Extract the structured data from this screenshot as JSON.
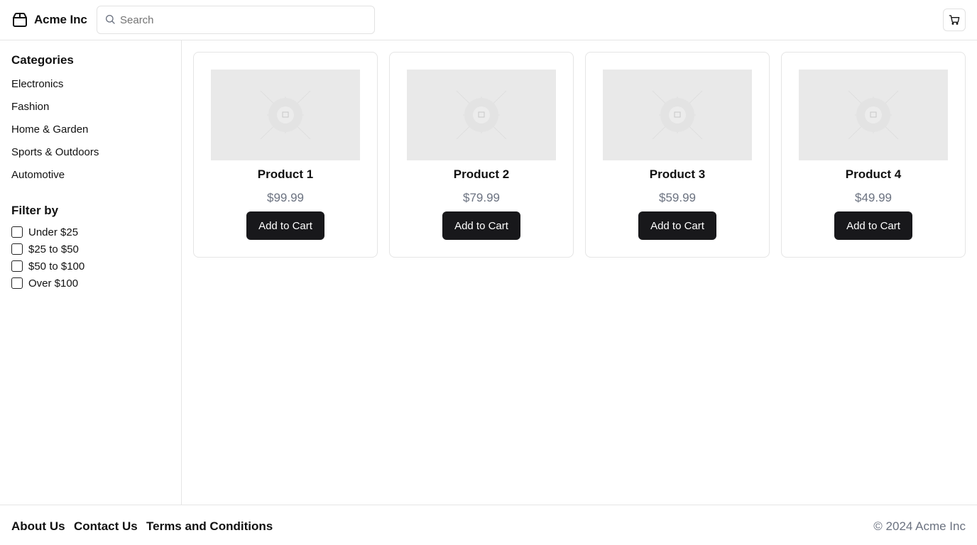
{
  "header": {
    "brand_name": "Acme Inc",
    "brand_icon": "package-icon",
    "search_placeholder": "Search",
    "search_value": "",
    "cart_icon": "shopping-cart-icon"
  },
  "sidebar": {
    "categories_heading": "Categories",
    "categories": [
      "Electronics",
      "Fashion",
      "Home & Garden",
      "Sports & Outdoors",
      "Automotive"
    ],
    "filter_heading": "Filter by",
    "filters": [
      {
        "label": "Under $25",
        "checked": false
      },
      {
        "label": "$25 to $50",
        "checked": false
      },
      {
        "label": "$50 to $100",
        "checked": false
      },
      {
        "label": "Over $100",
        "checked": false
      }
    ]
  },
  "products": [
    {
      "name": "Product 1",
      "price": "$99.99",
      "button": "Add to Cart"
    },
    {
      "name": "Product 2",
      "price": "$79.99",
      "button": "Add to Cart"
    },
    {
      "name": "Product 3",
      "price": "$59.99",
      "button": "Add to Cart"
    },
    {
      "name": "Product 4",
      "price": "$49.99",
      "button": "Add to Cart"
    }
  ],
  "footer": {
    "links": [
      "About Us",
      "Contact Us",
      "Terms and Conditions"
    ],
    "copyright": "© 2024 Acme Inc"
  },
  "colors": {
    "primary_button": "#18181b",
    "border": "#e5e5e5",
    "muted_text": "#6b7280",
    "placeholder_bg": "#e9e9e9"
  }
}
